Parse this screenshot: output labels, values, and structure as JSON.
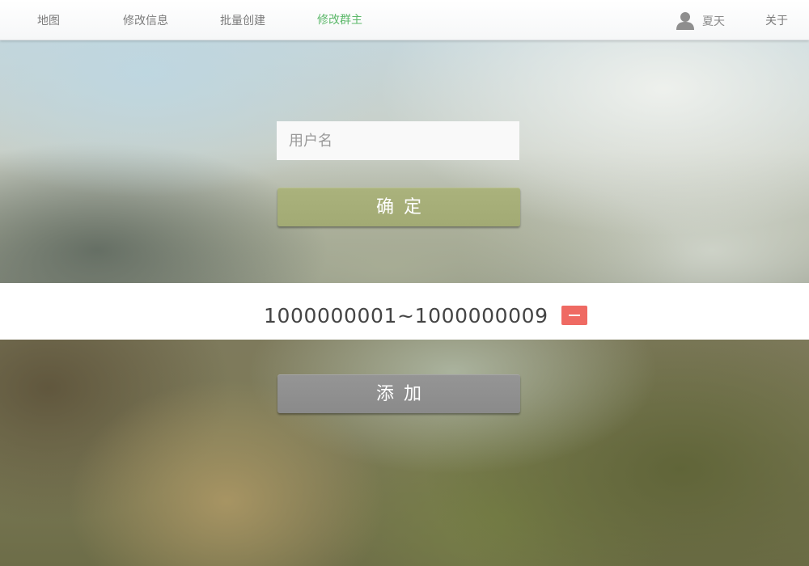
{
  "nav": {
    "items": [
      {
        "label": "地图"
      },
      {
        "label": "修改信息"
      },
      {
        "label": "批量创建"
      },
      {
        "label": "修改群主"
      }
    ],
    "active_index": 3,
    "active_color": "#5cb86a",
    "user": {
      "name": "夏天",
      "icon": "user-icon"
    },
    "about_label": "关于"
  },
  "form": {
    "username_placeholder": "用户名",
    "username_value": "",
    "confirm_label": "确定",
    "confirm_color": "#a7af79"
  },
  "range": {
    "text": "1000000001~1000000009",
    "remove_icon": "minus-icon",
    "remove_color": "#ef6a63"
  },
  "add": {
    "label": "添加",
    "color": "#909090"
  }
}
